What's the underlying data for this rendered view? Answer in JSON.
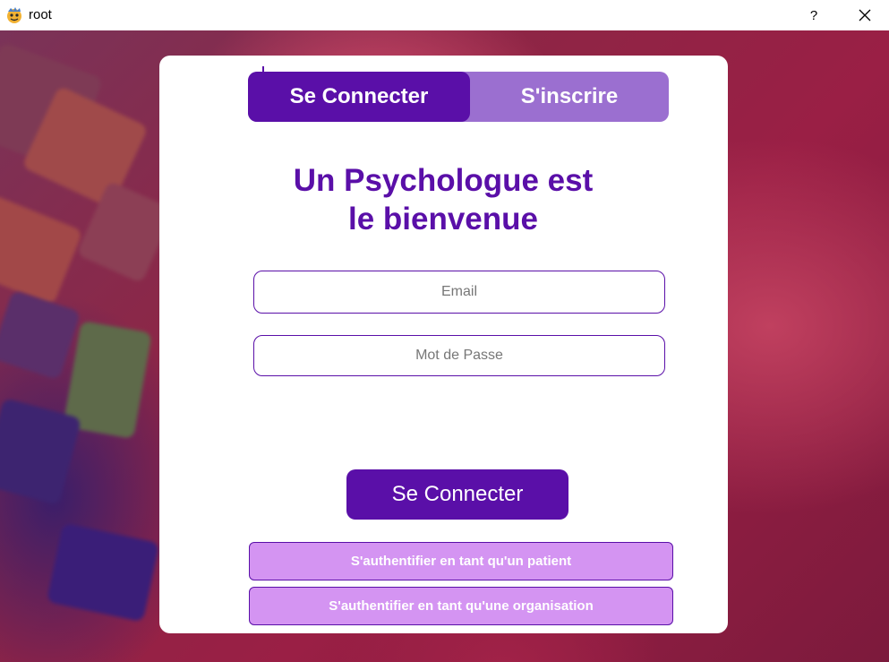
{
  "window": {
    "title": "root",
    "help_label": "?",
    "icons": {
      "app": "app-emoji-icon",
      "close": "close-icon"
    }
  },
  "tabs": {
    "login": "Se Connecter",
    "signup": "S'inscrire"
  },
  "heading": {
    "line1": "Un Psychologue est",
    "line2": "le bienvenue"
  },
  "form": {
    "email_placeholder": "Email",
    "password_placeholder": "Mot de Passe",
    "submit_label": "Se Connecter"
  },
  "alt_auth": {
    "patient": "S'authentifier en tant qu'un patient",
    "organisation": "S'authentifier en tant qu'une organisation"
  },
  "colors": {
    "primary": "#5a0fa8",
    "tab_inactive": "#9b6fd0",
    "alt_button": "#d494f2"
  }
}
